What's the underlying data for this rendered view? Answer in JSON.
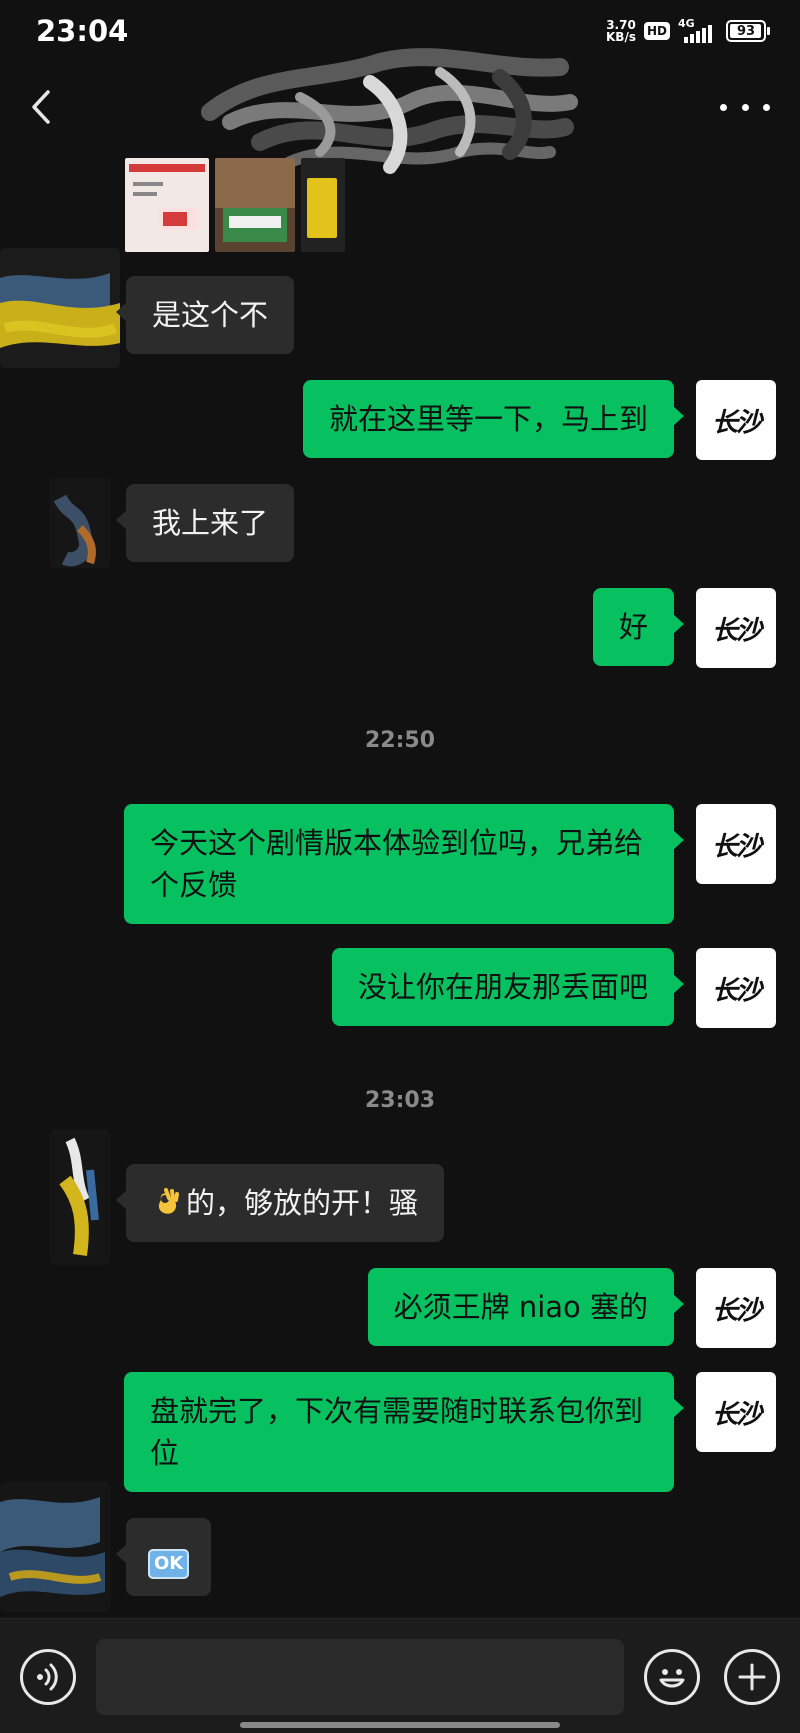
{
  "status_bar": {
    "time": "23:04",
    "net_speed_value": "3.70",
    "net_speed_unit": "KB/s",
    "hd_label": "HD",
    "network_label": "4G",
    "battery_level": "93"
  },
  "header": {
    "back_icon": "chevron-left-icon",
    "more_icon": "ellipsis-icon"
  },
  "messages": [
    {
      "side": "in",
      "text": "是这个不"
    },
    {
      "side": "out",
      "text": "就在这里等一下，马上到"
    },
    {
      "side": "in",
      "text": "我上来了"
    },
    {
      "side": "out",
      "text": "好"
    },
    {
      "side": "timestamp",
      "text": "22:50"
    },
    {
      "side": "out",
      "text": "今天这个剧情版本体验到位吗，兄弟给个反馈"
    },
    {
      "side": "out",
      "text": "没让你在朋友那丢面吧"
    },
    {
      "side": "timestamp",
      "text": "23:03"
    },
    {
      "side": "in",
      "text": "的，够放的开！骚",
      "emoji": "ok-hand-emoji"
    },
    {
      "side": "out",
      "text": "必须王牌 niao 塞的"
    },
    {
      "side": "out",
      "text": "盘就完了，下次有需要随时联系包你到位"
    },
    {
      "side": "in",
      "text": "OK",
      "emoji": "ok-button-emoji"
    }
  ],
  "my_avatar_text": "长沙",
  "input_bar": {
    "voice_icon": "voice-icon",
    "emoji_icon": "smiley-icon",
    "plus_icon": "plus-icon",
    "input_value": ""
  },
  "colors": {
    "background": "#111111",
    "incoming_bubble": "#2c2c2c",
    "outgoing_bubble": "#07c160",
    "timestamp": "#8a8a8a"
  }
}
